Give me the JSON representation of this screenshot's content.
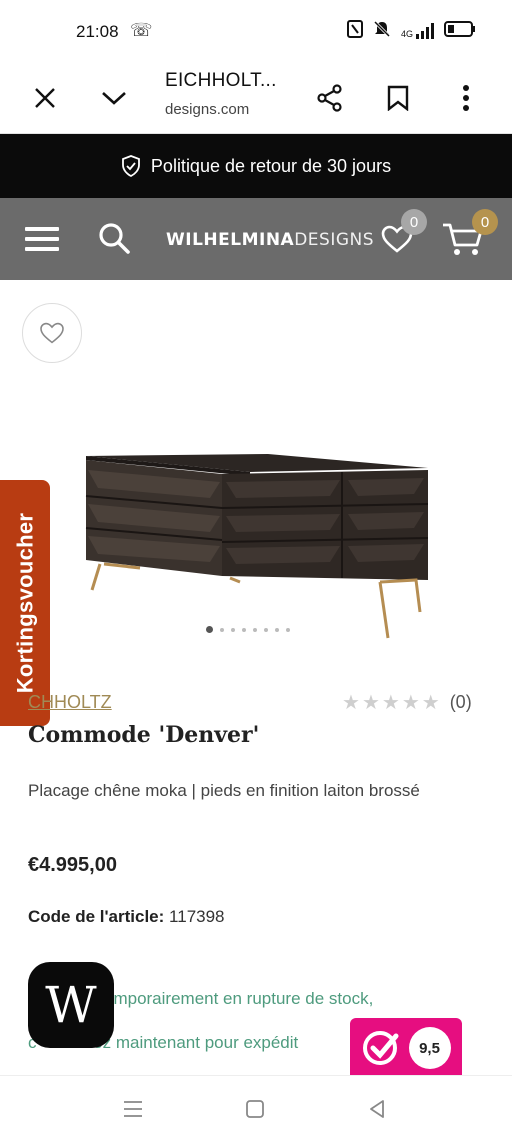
{
  "status_bar": {
    "time": "21:08",
    "network_label": "4G"
  },
  "browser": {
    "tab_title": "EICHHOLT...",
    "url": "designs.com"
  },
  "promo": {
    "text": "Politique de retour de 30 jours"
  },
  "header": {
    "logo_bold": "WILHELMINA",
    "logo_thin": "DESIGNS",
    "wishlist_count": "0",
    "cart_count": "0",
    "cart_badge_color": "#b5934e",
    "wishlist_badge_color": "#a7a7a7"
  },
  "voucher": {
    "label": "Kortingsvoucher",
    "color": "#b83c12"
  },
  "product": {
    "brand": "EICHHOLTZ",
    "brand_visible": "CHHOLTZ",
    "rating_count": "(0)",
    "title": "Commode 'Denver'",
    "description": "Placage chêne moka | pieds en finition laiton brossé",
    "price": "€4.995,00",
    "sku_label": "Code de l'article:",
    "sku_value": "117398",
    "stock_line1": "emporairement en rupture de stock,",
    "stock_line2": "c          dez maintenant pour expédit            e 2026",
    "stock_color": "#4e9b7e"
  },
  "image_carousel": {
    "total_slides": 8,
    "active_slide": 1
  },
  "floating": {
    "w_button_letter": "W",
    "review_score": "9,5",
    "review_color": "#e60e80"
  }
}
